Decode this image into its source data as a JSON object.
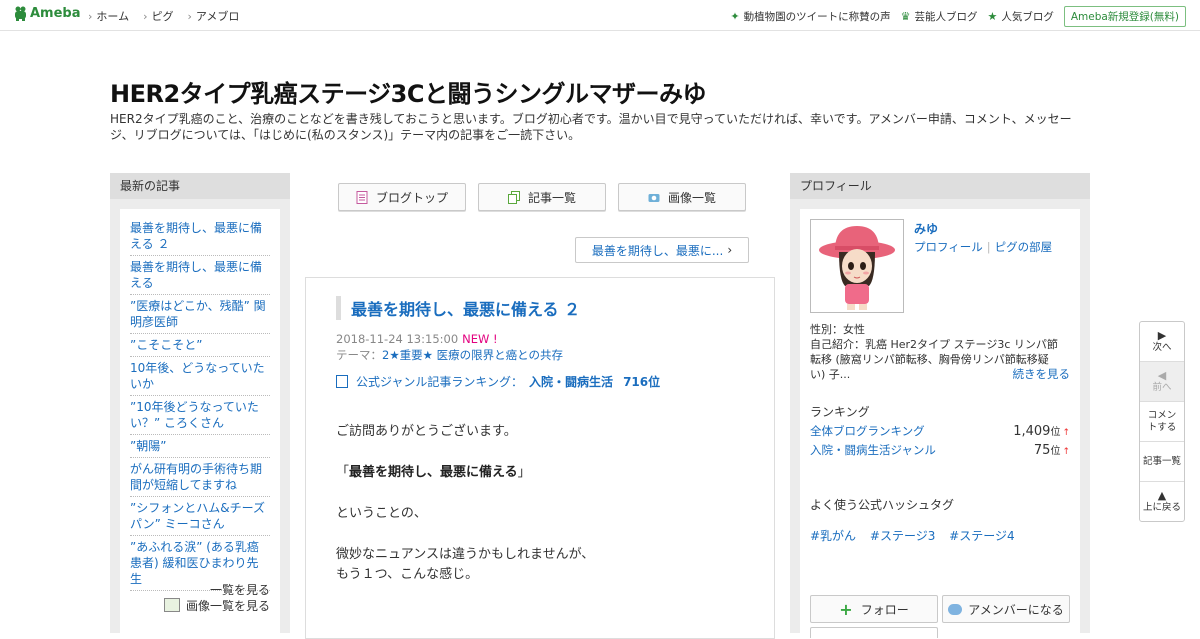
{
  "header": {
    "logo_text": "Ameba",
    "nav": [
      "ホーム",
      "ピグ",
      "アメブロ"
    ],
    "right_items": [
      {
        "icon": "sparkle-icon",
        "label": "動植物園のツイートに称賛の声"
      },
      {
        "icon": "crown-icon",
        "label": "芸能人ブログ"
      },
      {
        "icon": "star-icon",
        "label": "人気ブログ"
      }
    ],
    "register_label": "Ameba新規登録(無料)"
  },
  "blog": {
    "title": "HER2タイプ乳癌ステージ3Cと闘うシングルマザーみゆ",
    "description": "HER2タイプ乳癌のこと、治療のことなどを書き残しておこうと思います。ブログ初心者です。温かい目で見守っていただければ、幸いです。アメンバー申請、コメント、メッセージ、リブログについては、「はじめに(私のスタンス)」テーマ内の記事をご一読下さい。"
  },
  "left_sidebar": {
    "heading": "最新の記事",
    "items": [
      "最善を期待し、最悪に備える ２",
      "最善を期待し、最悪に備える",
      "”医療はどこか、残酷” 関明彦医師",
      "”こそこそと”",
      "10年後、どうなっていたいか",
      "”10年後どうなっていたい？” ころくさん",
      "”朝陽”",
      "がん研有明の手術待ち期間が短縮してますね",
      "”シフォンとハム&チーズパン” ミーコさん",
      "”あふれる涙” (ある乳癌患者) 緩和医ひまわり先生"
    ],
    "see_all": "一覧を見る",
    "see_images": "画像一覧を見る"
  },
  "tabs": {
    "blog_top": "ブログトップ",
    "article_list": "記事一覧",
    "image_list": "画像一覧"
  },
  "next_article": "最善を期待し、最悪に...",
  "article": {
    "title": "最善を期待し、最悪に備える ２",
    "date": "2018-11-24 13:15:00",
    "new_label": "NEW !",
    "theme_prefix": "テーマ：",
    "theme": "2★重要★ 医療の限界と癌との共存",
    "ranking_label": "公式ジャンル記事ランキング：",
    "ranking_genre": "入院・闘病生活",
    "ranking_value": "716位",
    "p1": "ご訪問ありがとうございます。",
    "p2_open": "「",
    "p2_bold": "最善を期待し、最悪に備える",
    "p2_close": "」",
    "p3": "ということの、",
    "p4_line1": "微妙なニュアンスは違うかもしれませんが、",
    "p4_line2": "もう１つ、こんな感じ。"
  },
  "profile": {
    "heading": "プロフィール",
    "name": "みゆ",
    "profile_link": "プロフィール",
    "pig_link": "ピグの部屋",
    "gender": "性別：女性",
    "intro": "自己紹介：乳癌 Her2タイプ ステージ3c リンパ節転移 (腋窩リンパ節転移、胸骨傍リンパ節転移疑い) 子...",
    "read_more": "続きを見る",
    "ranking_heading": "ランキング",
    "rank_rows": [
      {
        "label": "全体ブログランキング",
        "value": "1,409",
        "unit": "位",
        "arrow": "↑"
      },
      {
        "label": "入院・闘病生活ジャンル",
        "value": "75",
        "unit": "位",
        "arrow": "↑"
      }
    ],
    "hashtag_heading": "よく使う公式ハッシュタグ",
    "hashtags": [
      "#乳がん",
      "#ステージ3",
      "#ステージ4"
    ],
    "follow_label": "フォロー",
    "member_label": "アメンバーになる"
  },
  "floatnav": {
    "next": "次へ",
    "prev": "前へ",
    "comment": "コメントする",
    "article_list": "記事一覧",
    "top": "上に戻る"
  },
  "colors": {
    "link": "#1a6dbe",
    "brand_green": "#2d8c3c",
    "new_pink": "#e3007f"
  }
}
